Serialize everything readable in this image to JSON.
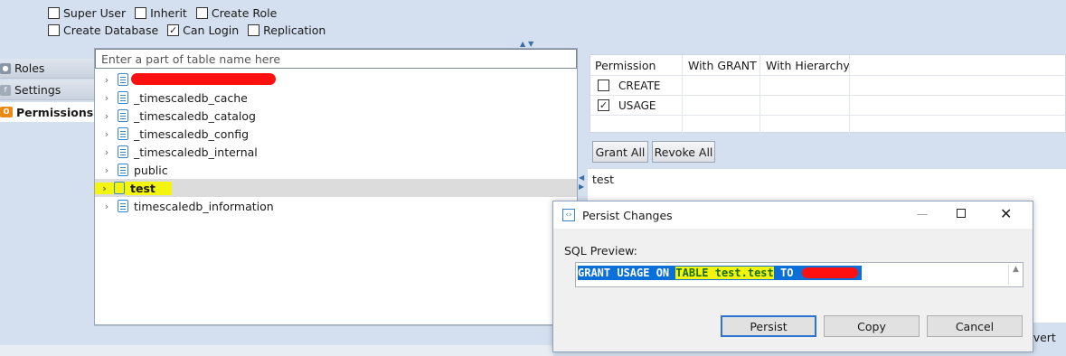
{
  "role_options": {
    "row1": [
      {
        "label": "Super User",
        "checked": false
      },
      {
        "label": "Inherit",
        "checked": false
      },
      {
        "label": "Create Role",
        "checked": false
      }
    ],
    "row2": [
      {
        "label": "Create Database",
        "checked": false
      },
      {
        "label": "Can Login",
        "checked": true
      },
      {
        "label": "Replication",
        "checked": false
      }
    ]
  },
  "nav": {
    "items": [
      {
        "label": "Roles",
        "icon": "roles-icon"
      },
      {
        "label": "Settings",
        "icon": "settings-icon"
      },
      {
        "label": "Permissions",
        "icon": "permissions-icon",
        "active": true
      }
    ]
  },
  "tree": {
    "filter_placeholder": "Enter a part of table name here",
    "items": [
      {
        "label": ""
      },
      {
        "label": "_timescaledb_cache"
      },
      {
        "label": "_timescaledb_catalog"
      },
      {
        "label": "_timescaledb_config"
      },
      {
        "label": "_timescaledb_internal"
      },
      {
        "label": "public"
      },
      {
        "label": "test",
        "selected": true
      },
      {
        "label": "timescaledb_information"
      }
    ]
  },
  "permissions": {
    "headers": [
      "Permission",
      "With GRANT",
      "With Hierarchy"
    ],
    "rows": [
      {
        "label": "CREATE",
        "checked": false
      },
      {
        "label": "USAGE",
        "checked": true
      }
    ],
    "grant_all": "Grant All",
    "revoke_all": "Revoke All",
    "detail_text": "test",
    "revert_fragment": "evert"
  },
  "dialog": {
    "title": "Persist Changes",
    "sql_label": "SQL Preview:",
    "sql_parts": [
      "GRANT USAGE ON ",
      "TABLE test.test",
      " TO "
    ],
    "persist": "Persist",
    "copy": "Copy",
    "cancel": "Cancel"
  },
  "colors": {
    "background": "#d4e0ef",
    "selection_blue": "#0a6fd8",
    "highlight_yellow": "#f4f50f",
    "redaction_red": "#ff1010"
  }
}
